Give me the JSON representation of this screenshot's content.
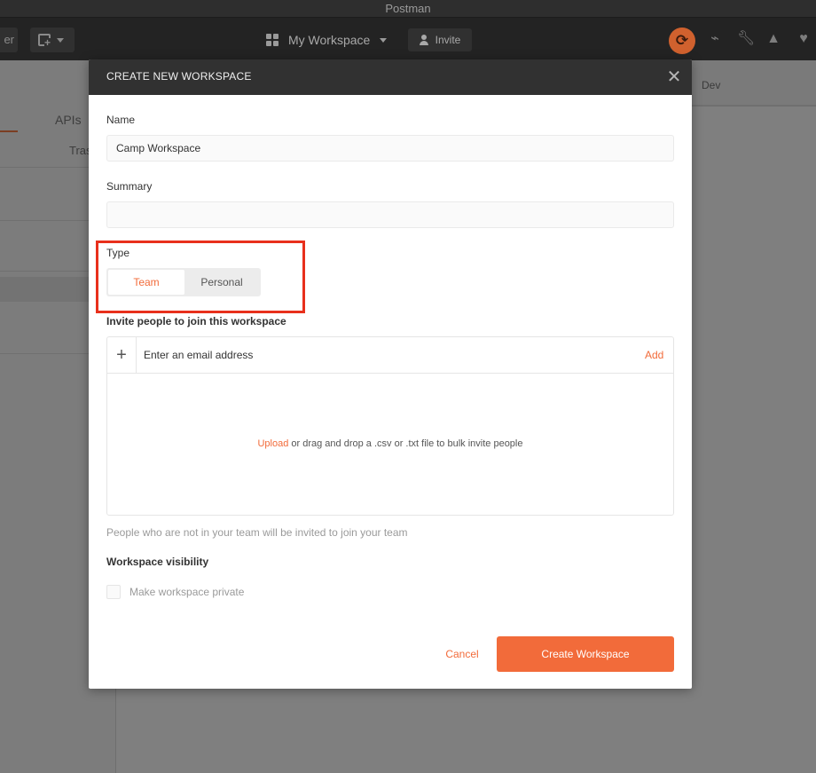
{
  "window": {
    "title": "Postman"
  },
  "header": {
    "left_button_label": "er",
    "workspace_label": "My Workspace",
    "invite_label": "Invite",
    "colors": {
      "sync_accent": "#d0612e"
    },
    "icons": [
      "new-icon",
      "grid-icon",
      "sync-icon",
      "satellite-icon",
      "wrench-icon",
      "bell-icon",
      "heart-icon"
    ]
  },
  "background": {
    "sidebar_tab": "APIs",
    "sidebar_trash_partial": "Tras",
    "env_label": "Dev"
  },
  "modal": {
    "title": "CREATE NEW WORKSPACE",
    "name_label": "Name",
    "name_value": "Camp Workspace",
    "summary_label": "Summary",
    "summary_value": "",
    "type_label": "Type",
    "type_options": [
      "Team",
      "Personal"
    ],
    "type_selected": "Team",
    "invite_heading": "Invite people to join this workspace",
    "email_placeholder": "Enter an email address",
    "add_label": "Add",
    "upload_link": "Upload",
    "upload_text": " or drag and drop a .csv or .txt file to bulk invite people",
    "invite_hint": "People who are not in your team will be invited to join your team",
    "visibility_heading": "Workspace visibility",
    "private_label": "Make workspace private",
    "private_checked": false,
    "cancel_label": "Cancel",
    "create_label": "Create Workspace",
    "colors": {
      "accent": "#f26b3a",
      "highlight": "#e8301c"
    }
  }
}
